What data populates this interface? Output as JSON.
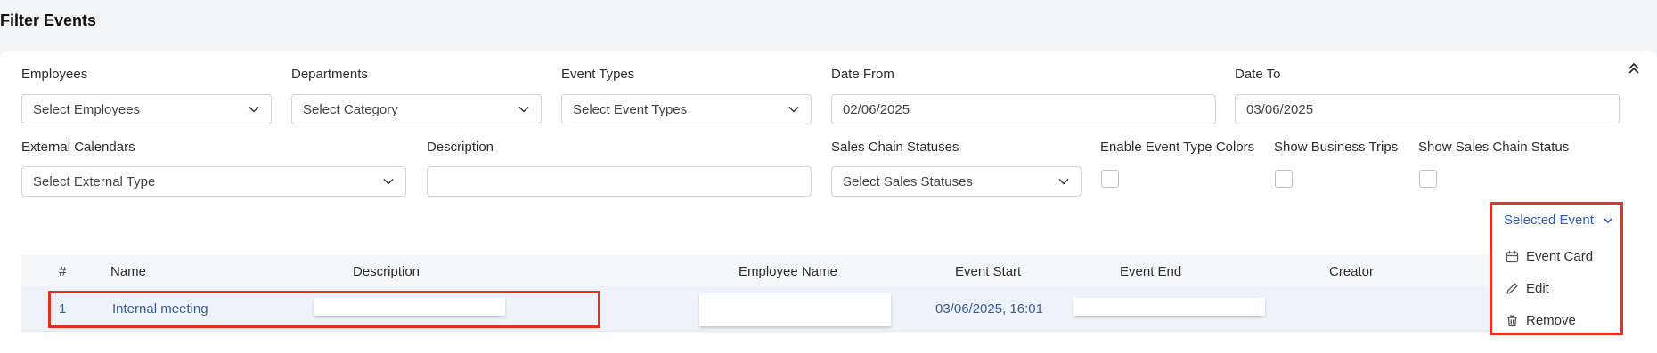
{
  "page_title": "Filter Events",
  "filters": {
    "employees": {
      "label": "Employees",
      "placeholder": "Select Employees"
    },
    "departments": {
      "label": "Departments",
      "placeholder": "Select Category"
    },
    "event_types": {
      "label": "Event Types",
      "placeholder": "Select Event Types"
    },
    "date_from": {
      "label": "Date From",
      "value": "02/06/2025"
    },
    "date_to": {
      "label": "Date To",
      "value": "03/06/2025"
    },
    "external_calendars": {
      "label": "External Calendars",
      "placeholder": "Select External Type"
    },
    "description": {
      "label": "Description",
      "value": ""
    },
    "sales_chain_statuses": {
      "label": "Sales Chain Statuses",
      "placeholder": "Select Sales Statuses"
    },
    "enable_event_type_colors": {
      "label": "Enable Event Type Colors",
      "checked": false
    },
    "show_business_trips": {
      "label": "Show Business Trips",
      "checked": false
    },
    "show_sales_chain_status": {
      "label": "Show Sales Chain Status",
      "checked": false
    }
  },
  "table": {
    "columns": [
      "#",
      "Name",
      "Description",
      "Employee Name",
      "Event Start",
      "Event End",
      "Creator"
    ],
    "rows": [
      {
        "num": "1",
        "name": "Internal meeting",
        "event_start": "03/06/2025, 16:01"
      }
    ]
  },
  "action_menu": {
    "toggle_label": "Selected Event",
    "items": [
      {
        "label": "Event Card",
        "icon": "calendar-icon"
      },
      {
        "label": "Edit",
        "icon": "pencil-icon"
      },
      {
        "label": "Remove",
        "icon": "trash-icon"
      }
    ]
  },
  "colors": {
    "accent": "#2f5bb7",
    "highlight": "#e3321f",
    "row_selected": "#eef3fb"
  }
}
